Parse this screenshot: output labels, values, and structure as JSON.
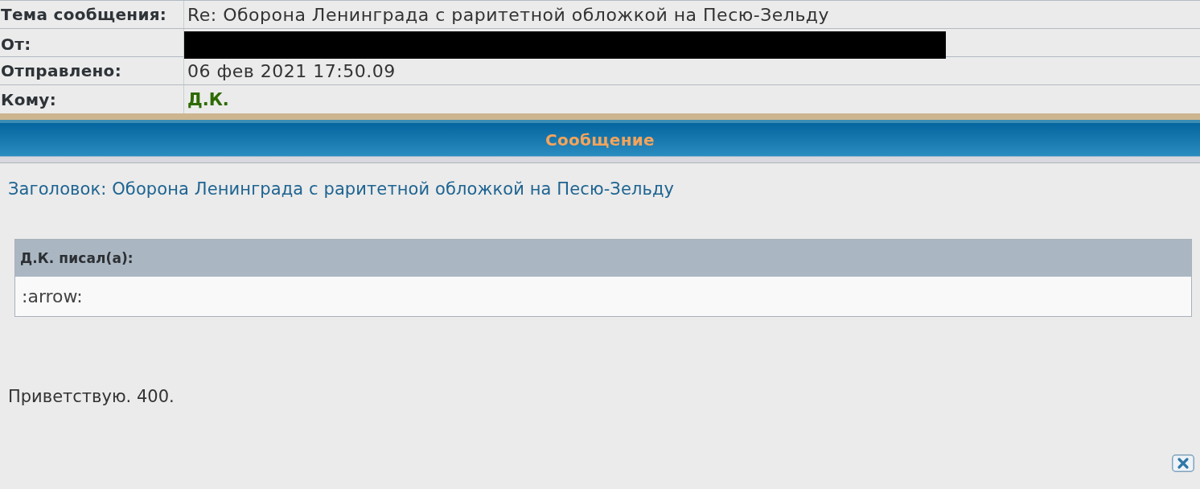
{
  "header_fields": [
    {
      "kind": "text",
      "label": "Тема сообщения:",
      "value": "Re: Оборона Ленинграда с раритетной обложкой на Песю-Зельду"
    },
    {
      "kind": "redacted",
      "label": "От:"
    },
    {
      "kind": "text",
      "label": "Отправлено:",
      "value": "06 фев 2021 17:50.09"
    },
    {
      "kind": "user",
      "label": "Кому:",
      "value": "Д.К."
    }
  ],
  "message_section": {
    "title": "Сообщение"
  },
  "post": {
    "subject": "Заголовок: Оборона Ленинграда с раритетной обложкой на Песю-Зельду",
    "quote": {
      "author": "Д.К. писал(а):",
      "text": ":arrow:"
    },
    "body": "Приветствую. 400."
  }
}
